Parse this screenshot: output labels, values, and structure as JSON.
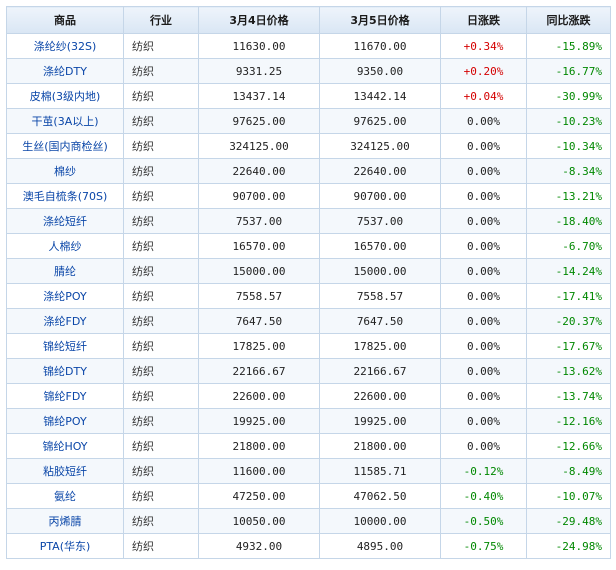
{
  "colors": {
    "up": "#d40000",
    "down": "#008800",
    "flat": "#222222",
    "name": "#0a46a8"
  },
  "headers": [
    "商品",
    "行业",
    "3月4日价格",
    "3月5日价格",
    "日涨跌",
    "同比涨跌"
  ],
  "rows": [
    {
      "name": "涤纶纱(32S)",
      "industry": "纺织",
      "price_mar4": "11630.00",
      "price_mar5": "11670.00",
      "daily_change": "+0.34%",
      "daily_trend": "up",
      "yoy_change": "-15.89%"
    },
    {
      "name": "涤纶DTY",
      "industry": "纺织",
      "price_mar4": "9331.25",
      "price_mar5": "9350.00",
      "daily_change": "+0.20%",
      "daily_trend": "up",
      "yoy_change": "-16.77%"
    },
    {
      "name": "皮棉(3级内地)",
      "industry": "纺织",
      "price_mar4": "13437.14",
      "price_mar5": "13442.14",
      "daily_change": "+0.04%",
      "daily_trend": "up",
      "yoy_change": "-30.99%"
    },
    {
      "name": "干茧(3A以上)",
      "industry": "纺织",
      "price_mar4": "97625.00",
      "price_mar5": "97625.00",
      "daily_change": "0.00%",
      "daily_trend": "flat",
      "yoy_change": "-10.23%"
    },
    {
      "name": "生丝(国内商检丝)",
      "industry": "纺织",
      "price_mar4": "324125.00",
      "price_mar5": "324125.00",
      "daily_change": "0.00%",
      "daily_trend": "flat",
      "yoy_change": "-10.34%"
    },
    {
      "name": "棉纱",
      "industry": "纺织",
      "price_mar4": "22640.00",
      "price_mar5": "22640.00",
      "daily_change": "0.00%",
      "daily_trend": "flat",
      "yoy_change": "-8.34%"
    },
    {
      "name": "澳毛自梳条(70S)",
      "industry": "纺织",
      "price_mar4": "90700.00",
      "price_mar5": "90700.00",
      "daily_change": "0.00%",
      "daily_trend": "flat",
      "yoy_change": "-13.21%"
    },
    {
      "name": "涤纶短纤",
      "industry": "纺织",
      "price_mar4": "7537.00",
      "price_mar5": "7537.00",
      "daily_change": "0.00%",
      "daily_trend": "flat",
      "yoy_change": "-18.40%"
    },
    {
      "name": "人棉纱",
      "industry": "纺织",
      "price_mar4": "16570.00",
      "price_mar5": "16570.00",
      "daily_change": "0.00%",
      "daily_trend": "flat",
      "yoy_change": "-6.70%"
    },
    {
      "name": "腈纶",
      "industry": "纺织",
      "price_mar4": "15000.00",
      "price_mar5": "15000.00",
      "daily_change": "0.00%",
      "daily_trend": "flat",
      "yoy_change": "-14.24%"
    },
    {
      "name": "涤纶POY",
      "industry": "纺织",
      "price_mar4": "7558.57",
      "price_mar5": "7558.57",
      "daily_change": "0.00%",
      "daily_trend": "flat",
      "yoy_change": "-17.41%"
    },
    {
      "name": "涤纶FDY",
      "industry": "纺织",
      "price_mar4": "7647.50",
      "price_mar5": "7647.50",
      "daily_change": "0.00%",
      "daily_trend": "flat",
      "yoy_change": "-20.37%"
    },
    {
      "name": "锦纶短纤",
      "industry": "纺织",
      "price_mar4": "17825.00",
      "price_mar5": "17825.00",
      "daily_change": "0.00%",
      "daily_trend": "flat",
      "yoy_change": "-17.67%"
    },
    {
      "name": "锦纶DTY",
      "industry": "纺织",
      "price_mar4": "22166.67",
      "price_mar5": "22166.67",
      "daily_change": "0.00%",
      "daily_trend": "flat",
      "yoy_change": "-13.62%"
    },
    {
      "name": "锦纶FDY",
      "industry": "纺织",
      "price_mar4": "22600.00",
      "price_mar5": "22600.00",
      "daily_change": "0.00%",
      "daily_trend": "flat",
      "yoy_change": "-13.74%"
    },
    {
      "name": "锦纶POY",
      "industry": "纺织",
      "price_mar4": "19925.00",
      "price_mar5": "19925.00",
      "daily_change": "0.00%",
      "daily_trend": "flat",
      "yoy_change": "-12.16%"
    },
    {
      "name": "锦纶HOY",
      "industry": "纺织",
      "price_mar4": "21800.00",
      "price_mar5": "21800.00",
      "daily_change": "0.00%",
      "daily_trend": "flat",
      "yoy_change": "-12.66%"
    },
    {
      "name": "粘胶短纤",
      "industry": "纺织",
      "price_mar4": "11600.00",
      "price_mar5": "11585.71",
      "daily_change": "-0.12%",
      "daily_trend": "down",
      "yoy_change": "-8.49%"
    },
    {
      "name": "氨纶",
      "industry": "纺织",
      "price_mar4": "47250.00",
      "price_mar5": "47062.50",
      "daily_change": "-0.40%",
      "daily_trend": "down",
      "yoy_change": "-10.07%"
    },
    {
      "name": "丙烯腈",
      "industry": "纺织",
      "price_mar4": "10050.00",
      "price_mar5": "10000.00",
      "daily_change": "-0.50%",
      "daily_trend": "down",
      "yoy_change": "-29.48%"
    },
    {
      "name": "PTA(华东)",
      "industry": "纺织",
      "price_mar4": "4932.00",
      "price_mar5": "4895.00",
      "daily_change": "-0.75%",
      "daily_trend": "down",
      "yoy_change": "-24.98%"
    }
  ]
}
